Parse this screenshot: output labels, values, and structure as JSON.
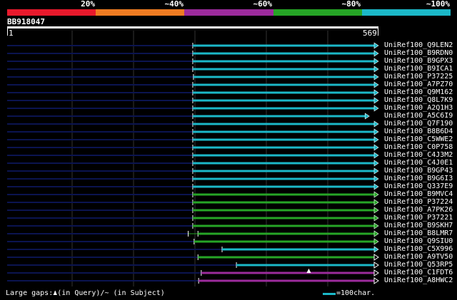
{
  "legend": {
    "segments": [
      {
        "label": "20%",
        "color": "#e8192c"
      },
      {
        "label": "~40%",
        "color": "#ef7c22"
      },
      {
        "label": "~60%",
        "color": "#9c2b9c"
      },
      {
        "label": "~80%",
        "color": "#26a526"
      },
      {
        "label": "~100%",
        "color": "#1bb8c8"
      }
    ]
  },
  "query": {
    "name": "BB918047",
    "start": "1",
    "end": "569",
    "length": 569
  },
  "hits": [
    {
      "name": "UniRef100_Q9LEN2",
      "qstart": 285,
      "qend": 569,
      "tail_start": 0,
      "color": "#1bb8c8",
      "arrow": "filled"
    },
    {
      "name": "UniRef100_B9RDN0",
      "qstart": 285,
      "qend": 569,
      "tail_start": 0,
      "color": "#1bb8c8",
      "arrow": "filled"
    },
    {
      "name": "UniRef100_B9GPX3",
      "qstart": 285,
      "qend": 569,
      "tail_start": 0,
      "color": "#1bb8c8",
      "arrow": "filled"
    },
    {
      "name": "UniRef100_B9ICA1",
      "qstart": 285,
      "qend": 569,
      "tail_start": 0,
      "color": "#1bb8c8",
      "arrow": "filled"
    },
    {
      "name": "UniRef100_P37225",
      "qstart": 286,
      "qend": 569,
      "tail_start": 0,
      "color": "#1bb8c8",
      "arrow": "filled"
    },
    {
      "name": "UniRef100_A7PZ70",
      "qstart": 285,
      "qend": 569,
      "tail_start": 0,
      "color": "#1bb8c8",
      "arrow": "filled"
    },
    {
      "name": "UniRef100_Q9M162",
      "qstart": 285,
      "qend": 569,
      "tail_start": 0,
      "color": "#1bb8c8",
      "arrow": "filled"
    },
    {
      "name": "UniRef100_Q8L7K9",
      "qstart": 285,
      "qend": 569,
      "tail_start": 0,
      "color": "#1bb8c8",
      "arrow": "filled"
    },
    {
      "name": "UniRef100_A2Q1H3",
      "qstart": 285,
      "qend": 569,
      "tail_start": 0,
      "color": "#1bb8c8",
      "arrow": "filled"
    },
    {
      "name": "UniRef100_A5C6I9",
      "qstart": 285,
      "qend": 555,
      "tail_start": 0,
      "color": "#1bb8c8",
      "arrow": "filled"
    },
    {
      "name": "UniRef100_Q7F190",
      "qstart": 285,
      "qend": 569,
      "tail_start": 0,
      "color": "#1bb8c8",
      "arrow": "filled"
    },
    {
      "name": "UniRef100_B8B6D4",
      "qstart": 285,
      "qend": 569,
      "tail_start": 0,
      "color": "#1bb8c8",
      "arrow": "filled"
    },
    {
      "name": "UniRef100_C5WWE2",
      "qstart": 285,
      "qend": 569,
      "tail_start": 0,
      "color": "#1bb8c8",
      "arrow": "filled"
    },
    {
      "name": "UniRef100_C0P758",
      "qstart": 285,
      "qend": 569,
      "tail_start": 0,
      "color": "#1bb8c8",
      "arrow": "filled"
    },
    {
      "name": "UniRef100_C4J3M2",
      "qstart": 285,
      "qend": 569,
      "tail_start": 0,
      "color": "#1bb8c8",
      "arrow": "filled"
    },
    {
      "name": "UniRef100_C4J0E1",
      "qstart": 285,
      "qend": 569,
      "tail_start": 0,
      "color": "#1bb8c8",
      "arrow": "filled"
    },
    {
      "name": "UniRef100_B9GP43",
      "qstart": 285,
      "qend": 569,
      "tail_start": 0,
      "color": "#1bb8c8",
      "arrow": "filled"
    },
    {
      "name": "UniRef100_B9G6I3",
      "qstart": 285,
      "qend": 569,
      "tail_start": 0,
      "color": "#1bb8c8",
      "arrow": "filled"
    },
    {
      "name": "UniRef100_Q337E9",
      "qstart": 285,
      "qend": 569,
      "tail_start": 0,
      "color": "#1bb8c8",
      "arrow": "filled"
    },
    {
      "name": "UniRef100_B9MVC4",
      "qstart": 285,
      "qend": 569,
      "tail_start": 0,
      "color": "#26a526",
      "arrow": "filled"
    },
    {
      "name": "UniRef100_P37224",
      "qstart": 285,
      "qend": 569,
      "tail_start": 0,
      "color": "#26a526",
      "arrow": "filled"
    },
    {
      "name": "UniRef100_A7PK26",
      "qstart": 285,
      "qend": 569,
      "tail_start": 0,
      "color": "#26a526",
      "arrow": "filled"
    },
    {
      "name": "UniRef100_P37221",
      "qstart": 285,
      "qend": 569,
      "tail_start": 0,
      "color": "#26a526",
      "arrow": "filled"
    },
    {
      "name": "UniRef100_B9SKH7",
      "qstart": 285,
      "qend": 569,
      "tail_start": 0,
      "color": "#26a526",
      "arrow": "filled"
    },
    {
      "name": "UniRef100_B8LMR7",
      "qstart": 293,
      "qend": 569,
      "tail_start": 0,
      "color": "#26a526",
      "arrow": "filled",
      "start_bar": true,
      "pre_start": 278
    },
    {
      "name": "UniRef100_Q9SIU0",
      "qstart": 287,
      "qend": 569,
      "tail_start": 0,
      "color": "#26a526",
      "arrow": "filled"
    },
    {
      "name": "UniRef100_C5X996",
      "qstart": 330,
      "qend": 569,
      "tail_start": 0,
      "color": "#1bb8c8",
      "arrow": "filled"
    },
    {
      "name": "UniRef100_A9TV50",
      "qstart": 293,
      "qend": 569,
      "tail_start": 0,
      "color": "#26a526",
      "arrow": "open"
    },
    {
      "name": "UniRef100_Q53RP5",
      "qstart": 352,
      "qend": 569,
      "tail_start": 0,
      "color": "#1bb8c8",
      "arrow": "open"
    },
    {
      "name": "UniRef100_C1FDT6",
      "qstart": 298,
      "qend": 569,
      "tail_start": 0,
      "color": "#9c2b9c",
      "arrow": "open",
      "gap_marker": 463
    },
    {
      "name": "UniRef100_A8HWC2",
      "qstart": 294,
      "qend": 569,
      "tail_start": 0,
      "color": "#9c2b9c",
      "arrow": "open"
    }
  ],
  "footer": {
    "gaps_text": "Large gaps:♟(in Query)/~ (in Subject)",
    "scale_text": "=100char.",
    "scale_color": "#1bb8c8"
  }
}
